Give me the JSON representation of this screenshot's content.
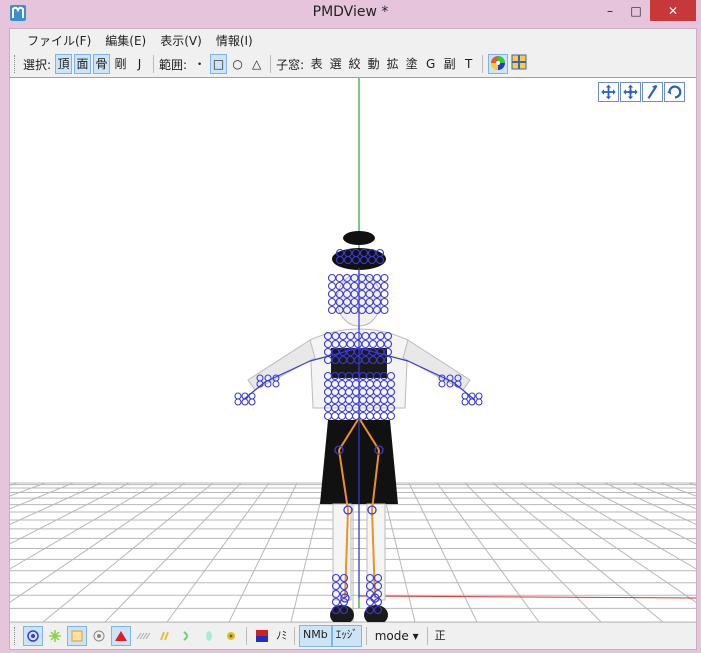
{
  "window": {
    "title": "PMDView *",
    "minimize": "–",
    "maximize": "□",
    "close": "✕"
  },
  "menu": [
    "ファイル(F)",
    "編集(E)",
    "表示(V)",
    "情報(I)"
  ],
  "toolbar": {
    "select_label": "選択:",
    "select_buttons": [
      {
        "label": "頂",
        "active": true
      },
      {
        "label": "面",
        "active": true
      },
      {
        "label": "骨",
        "active": true
      },
      {
        "label": "剛",
        "active": false
      },
      {
        "label": "J",
        "active": false
      }
    ],
    "range_label": "範囲:",
    "range_buttons": [
      {
        "label": "・",
        "active": false
      },
      {
        "label": "□",
        "active": true
      },
      {
        "label": "○",
        "active": false
      },
      {
        "label": "△",
        "active": false
      }
    ],
    "child_label": "子窓:",
    "child_buttons": [
      "表",
      "選",
      "絞",
      "動",
      "拡",
      "塗",
      "G",
      "副",
      "T"
    ]
  },
  "bottom": {
    "mode_label": "mode",
    "nomi_label": "ﾉﾐ",
    "nmo_label": "NMb",
    "edge_label": "ｴｯｼﾞ",
    "sei_label": "正"
  },
  "colors": {
    "accent": "#7eb4ea",
    "bone": "#3a3ad8",
    "leg_bone": "#f0911e",
    "axis_y": "#2aa02a",
    "axis_x": "#e03030"
  }
}
